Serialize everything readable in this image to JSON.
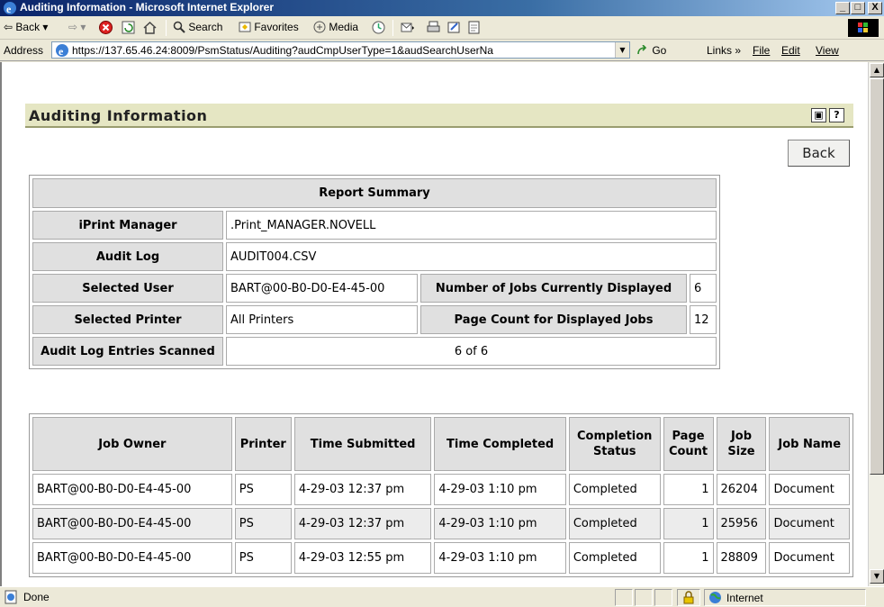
{
  "window": {
    "title": "Auditing Information - Microsoft Internet Explorer",
    "min": "_",
    "max": "□",
    "close": "X"
  },
  "toolbar": {
    "back": "Back",
    "search": "Search",
    "favorites": "Favorites",
    "media": "Media"
  },
  "address": {
    "label": "Address",
    "url": "https://137.65.46.24:8009/PsmStatus/Auditing?audCmpUserType=1&audSearchUserNa",
    "go": "Go",
    "links": "Links",
    "menu_file": "File",
    "menu_edit": "Edit",
    "menu_view": "View"
  },
  "page": {
    "header_title": "Auditing Information",
    "back_button": "Back"
  },
  "summary": {
    "heading": "Report Summary",
    "iprint_manager_label": "iPrint Manager",
    "iprint_manager_value": ".Print_MANAGER.NOVELL",
    "audit_log_label": "Audit Log",
    "audit_log_value": "AUDIT004.CSV",
    "selected_user_label": "Selected User",
    "selected_user_value": "BART@00-B0-D0-E4-45-00",
    "jobs_displayed_label": "Number of Jobs Currently Displayed",
    "jobs_displayed_value": "6",
    "selected_printer_label": "Selected Printer",
    "selected_printer_value": "All Printers",
    "page_count_label": "Page Count for Displayed Jobs",
    "page_count_value": "12",
    "entries_scanned_label": "Audit Log Entries Scanned",
    "entries_scanned_value": "6 of 6"
  },
  "jobs": {
    "headers": {
      "owner": "Job Owner",
      "printer": "Printer",
      "submitted": "Time Submitted",
      "completed": "Time Completed",
      "status_1": "Completion",
      "status_2": "Status",
      "pages_1": "Page",
      "pages_2": "Count",
      "size_1": "Job",
      "size_2": "Size",
      "name": "Job Name"
    },
    "rows": [
      {
        "owner": "BART@00-B0-D0-E4-45-00",
        "printer": "PS",
        "submitted": "4-29-03 12:37 pm",
        "completed": "4-29-03 1:10 pm",
        "status": "Completed",
        "pages": "1",
        "size": "26204",
        "name": "Document"
      },
      {
        "owner": "BART@00-B0-D0-E4-45-00",
        "printer": "PS",
        "submitted": "4-29-03 12:37 pm",
        "completed": "4-29-03 1:10 pm",
        "status": "Completed",
        "pages": "1",
        "size": "25956",
        "name": "Document"
      },
      {
        "owner": "BART@00-B0-D0-E4-45-00",
        "printer": "PS",
        "submitted": "4-29-03 12:55 pm",
        "completed": "4-29-03 1:10 pm",
        "status": "Completed",
        "pages": "1",
        "size": "28809",
        "name": "Document"
      }
    ]
  },
  "status": {
    "text": "Done",
    "zone": "Internet"
  }
}
